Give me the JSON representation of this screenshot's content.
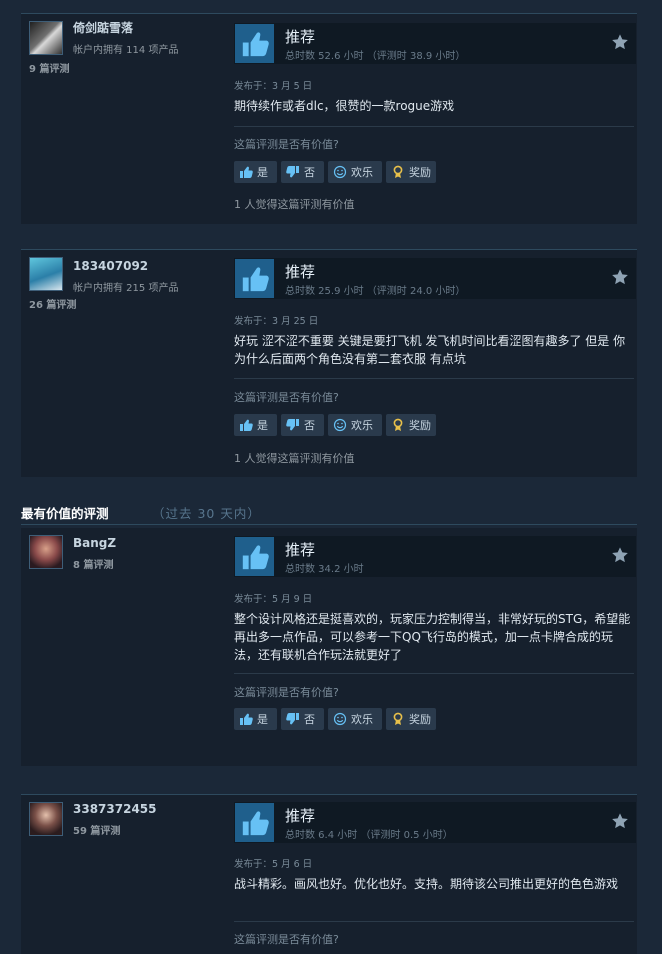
{
  "helpful_prompt": "这篇评测是否有价值?",
  "buttons": {
    "yes": "是",
    "no": "否",
    "funny": "欢乐",
    "award": "奖励"
  },
  "recommend_label": "推荐",
  "section": {
    "title": "最有价值的评测",
    "subtitle": "（过去 30 天内）"
  },
  "reviews": [
    {
      "user": "倚剑踮雪落",
      "owned": "帐户内拥有 114 项产品",
      "review_count": "9 篇评测",
      "hours": "总时数 52.6 小时 （评测时 38.9 小时）",
      "posted": "发布于：3 月 5 日",
      "text": "期待续作或者dlc，很赞的一款rogue游戏",
      "found_helpful": "1 人觉得这篇评测有价值"
    },
    {
      "user": "183407092",
      "owned": "帐户内拥有 215 项产品",
      "review_count": "26 篇评测",
      "hours": "总时数 25.9 小时 （评测时 24.0 小时）",
      "posted": "发布于：3 月 25 日",
      "text": "好玩 涩不涩不重要 关键是要打飞机 发飞机时间比看涩图有趣多了 但是 你为什么后面两个角色没有第二套衣服 有点坑",
      "found_helpful": "1 人觉得这篇评测有价值"
    },
    {
      "user": "BangZ",
      "review_count": "8 篇评测",
      "hours": "总时数 34.2 小时",
      "posted": "发布于：5 月 9 日",
      "text": "整个设计风格还是挺喜欢的，玩家压力控制得当，非常好玩的STG，希望能再出多一点作品，可以参考一下QQ飞行岛的模式，加一点卡牌合成的玩法，还有联机合作玩法就更好了"
    },
    {
      "user": "3387372455",
      "review_count": "59 篇评测",
      "hours": "总时数 6.4 小时 （评测时 0.5 小时）",
      "posted": "发布于：5 月 6 日",
      "text": "战斗精彩。画风也好。优化也好。支持。期待该公司推出更好的色色游戏"
    }
  ],
  "colors": {
    "background": "#1b2838",
    "card": "#16202d",
    "thumb_bg": "#1f5f8c",
    "award_icon": "#e8c04a"
  }
}
